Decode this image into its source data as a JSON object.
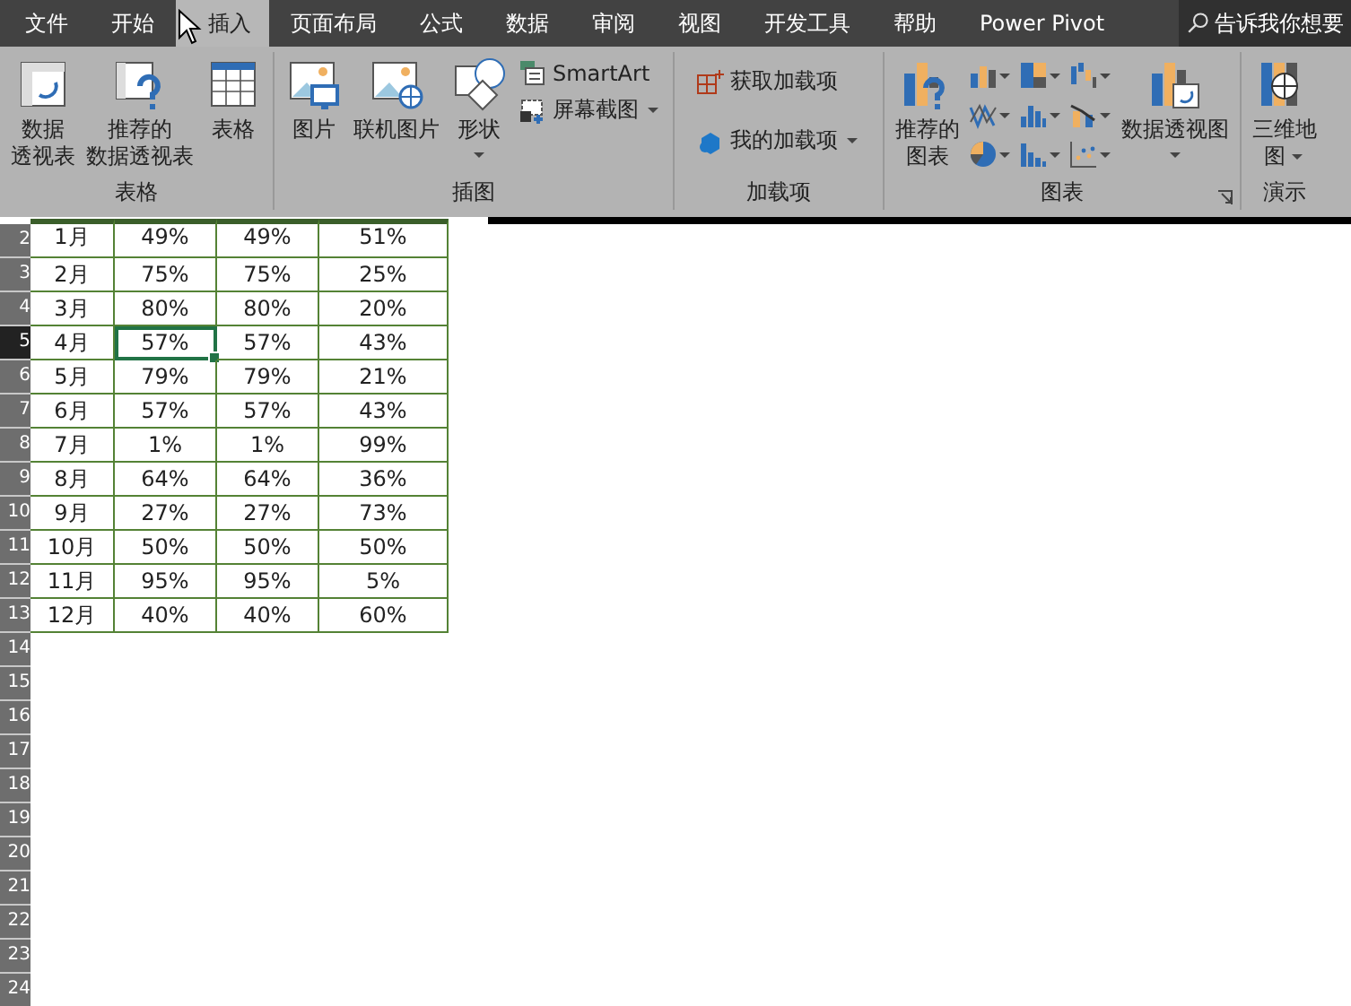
{
  "tabs": [
    {
      "label": "文件",
      "selected": false
    },
    {
      "label": "开始",
      "selected": false
    },
    {
      "label": "插入",
      "selected": true
    },
    {
      "label": "页面布局",
      "selected": false
    },
    {
      "label": "公式",
      "selected": false
    },
    {
      "label": "数据",
      "selected": false
    },
    {
      "label": "审阅",
      "selected": false
    },
    {
      "label": "视图",
      "selected": false
    },
    {
      "label": "开发工具",
      "selected": false
    },
    {
      "label": "帮助",
      "selected": false
    },
    {
      "label": "Power Pivot",
      "selected": false
    }
  ],
  "search": {
    "placeholder": "告诉我你想要"
  },
  "ribbon": {
    "groups": [
      {
        "label": "表格",
        "buttons": [
          {
            "kind": "large",
            "lines": [
              "数据",
              "透视表"
            ],
            "dropdown": false
          },
          {
            "kind": "large",
            "lines": [
              "推荐的",
              "数据透视表"
            ],
            "dropdown": false
          },
          {
            "kind": "large",
            "lines": [
              "表格"
            ],
            "dropdown": false
          }
        ]
      },
      {
        "label": "插图",
        "buttons": [
          {
            "kind": "large",
            "lines": [
              "图片"
            ],
            "dropdown": false
          },
          {
            "kind": "large",
            "lines": [
              "联机图片"
            ],
            "dropdown": false
          },
          {
            "kind": "large",
            "lines": [
              "形状"
            ],
            "dropdown": true
          },
          {
            "kind": "stack",
            "items": [
              {
                "label": "SmartArt",
                "dropdown": false
              },
              {
                "label": "屏幕截图",
                "dropdown": true
              }
            ]
          }
        ]
      },
      {
        "label": "加载项",
        "buttons": [
          {
            "kind": "stack",
            "items": [
              {
                "label": "获取加载项",
                "dropdown": false
              },
              {
                "label": "我的加载项",
                "dropdown": true
              }
            ]
          }
        ]
      },
      {
        "label": "图表",
        "launcher": true,
        "buttons": [
          {
            "kind": "large",
            "lines": [
              "推荐的",
              "图表"
            ],
            "dropdown": false
          },
          {
            "kind": "grid",
            "items": [
              {
                "dropdown": true
              },
              {
                "dropdown": true
              },
              {
                "dropdown": true
              },
              {
                "dropdown": true
              },
              {
                "dropdown": true
              },
              {
                "dropdown": true
              },
              {
                "dropdown": true
              },
              {
                "dropdown": true
              },
              {
                "dropdown": true
              }
            ]
          },
          {
            "kind": "large",
            "lines": [
              "数据透视图"
            ],
            "dropdown": true
          }
        ]
      },
      {
        "label": "演示",
        "buttons": [
          {
            "kind": "large",
            "lines": [
              "三维地",
              "图"
            ],
            "dropdown": true
          }
        ]
      }
    ]
  },
  "sheet": {
    "rows": [
      {
        "header": "2",
        "selected": false,
        "cells": [
          {
            "text": "1月",
            "selected": false
          },
          {
            "text": "49%",
            "selected": false
          },
          {
            "text": "49%",
            "selected": false
          },
          {
            "text": "51%",
            "selected": false
          }
        ]
      },
      {
        "header": "3",
        "selected": false,
        "cells": [
          {
            "text": "2月",
            "selected": false
          },
          {
            "text": "75%",
            "selected": false
          },
          {
            "text": "75%",
            "selected": false
          },
          {
            "text": "25%",
            "selected": false
          }
        ]
      },
      {
        "header": "4",
        "selected": false,
        "cells": [
          {
            "text": "3月",
            "selected": false
          },
          {
            "text": "80%",
            "selected": false
          },
          {
            "text": "80%",
            "selected": false
          },
          {
            "text": "20%",
            "selected": false
          }
        ]
      },
      {
        "header": "5",
        "selected": true,
        "cells": [
          {
            "text": "4月",
            "selected": false
          },
          {
            "text": "57%",
            "selected": true
          },
          {
            "text": "57%",
            "selected": false
          },
          {
            "text": "43%",
            "selected": false
          }
        ]
      },
      {
        "header": "6",
        "selected": false,
        "cells": [
          {
            "text": "5月",
            "selected": false
          },
          {
            "text": "79%",
            "selected": false
          },
          {
            "text": "79%",
            "selected": false
          },
          {
            "text": "21%",
            "selected": false
          }
        ]
      },
      {
        "header": "7",
        "selected": false,
        "cells": [
          {
            "text": "6月",
            "selected": false
          },
          {
            "text": "57%",
            "selected": false
          },
          {
            "text": "57%",
            "selected": false
          },
          {
            "text": "43%",
            "selected": false
          }
        ]
      },
      {
        "header": "8",
        "selected": false,
        "cells": [
          {
            "text": "7月",
            "selected": false
          },
          {
            "text": "1%",
            "selected": false
          },
          {
            "text": "1%",
            "selected": false
          },
          {
            "text": "99%",
            "selected": false
          }
        ]
      },
      {
        "header": "9",
        "selected": false,
        "cells": [
          {
            "text": "8月",
            "selected": false
          },
          {
            "text": "64%",
            "selected": false
          },
          {
            "text": "64%",
            "selected": false
          },
          {
            "text": "36%",
            "selected": false
          }
        ]
      },
      {
        "header": "10",
        "selected": false,
        "cells": [
          {
            "text": "9月",
            "selected": false
          },
          {
            "text": "27%",
            "selected": false
          },
          {
            "text": "27%",
            "selected": false
          },
          {
            "text": "73%",
            "selected": false
          }
        ]
      },
      {
        "header": "11",
        "selected": false,
        "cells": [
          {
            "text": "10月",
            "selected": false
          },
          {
            "text": "50%",
            "selected": false
          },
          {
            "text": "50%",
            "selected": false
          },
          {
            "text": "50%",
            "selected": false
          }
        ]
      },
      {
        "header": "12",
        "selected": false,
        "cells": [
          {
            "text": "11月",
            "selected": false
          },
          {
            "text": "95%",
            "selected": false
          },
          {
            "text": "95%",
            "selected": false
          },
          {
            "text": "5%",
            "selected": false
          }
        ]
      },
      {
        "header": "13",
        "selected": false,
        "cells": [
          {
            "text": "12月",
            "selected": false
          },
          {
            "text": "40%",
            "selected": false
          },
          {
            "text": "40%",
            "selected": false
          },
          {
            "text": "60%",
            "selected": false
          }
        ]
      },
      {
        "header": "14",
        "selected": false
      },
      {
        "header": "15",
        "selected": false
      },
      {
        "header": "16",
        "selected": false
      },
      {
        "header": "17",
        "selected": false
      },
      {
        "header": "18",
        "selected": false
      },
      {
        "header": "19",
        "selected": false
      },
      {
        "header": "20",
        "selected": false
      },
      {
        "header": "21",
        "selected": false
      },
      {
        "header": "22",
        "selected": false
      },
      {
        "header": "23",
        "selected": false
      },
      {
        "header": "24",
        "selected": false
      }
    ]
  }
}
